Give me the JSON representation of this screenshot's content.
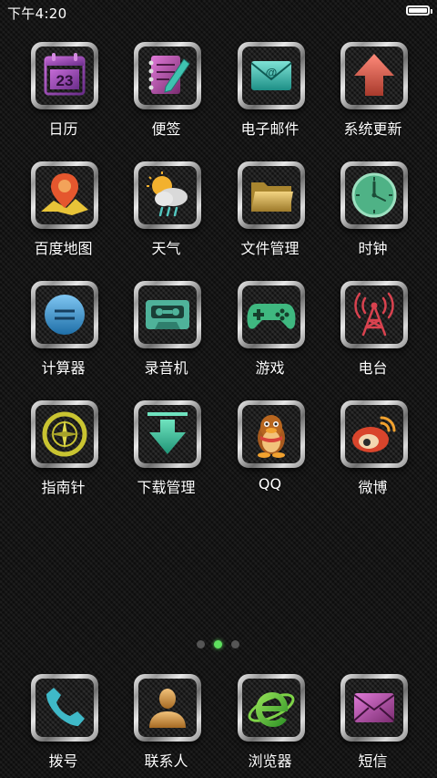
{
  "status_bar": {
    "time": "下午4:20",
    "battery_level": 1.0
  },
  "apps": [
    {
      "label": "日历",
      "icon": "calendar-icon",
      "day": "23"
    },
    {
      "label": "便签",
      "icon": "notepad-icon"
    },
    {
      "label": "电子邮件",
      "icon": "email-icon",
      "mark": "@"
    },
    {
      "label": "系统更新",
      "icon": "update-arrow-icon"
    },
    {
      "label": "百度地图",
      "icon": "map-pin-icon"
    },
    {
      "label": "天气",
      "icon": "weather-icon"
    },
    {
      "label": "文件管理",
      "icon": "folder-icon"
    },
    {
      "label": "时钟",
      "icon": "clock-icon"
    },
    {
      "label": "计算器",
      "icon": "calculator-icon"
    },
    {
      "label": "录音机",
      "icon": "cassette-icon"
    },
    {
      "label": "游戏",
      "icon": "gamepad-icon"
    },
    {
      "label": "电台",
      "icon": "radio-tower-icon"
    },
    {
      "label": "指南针",
      "icon": "compass-icon"
    },
    {
      "label": "下载管理",
      "icon": "download-arrow-icon"
    },
    {
      "label": "QQ",
      "icon": "qq-penguin-icon"
    },
    {
      "label": "微博",
      "icon": "weibo-icon"
    }
  ],
  "page_indicator": {
    "count": 3,
    "active": 1
  },
  "dock": [
    {
      "label": "拨号",
      "icon": "phone-icon"
    },
    {
      "label": "联系人",
      "icon": "contact-person-icon"
    },
    {
      "label": "浏览器",
      "icon": "browser-e-icon"
    },
    {
      "label": "短信",
      "icon": "message-envelope-icon"
    }
  ]
}
